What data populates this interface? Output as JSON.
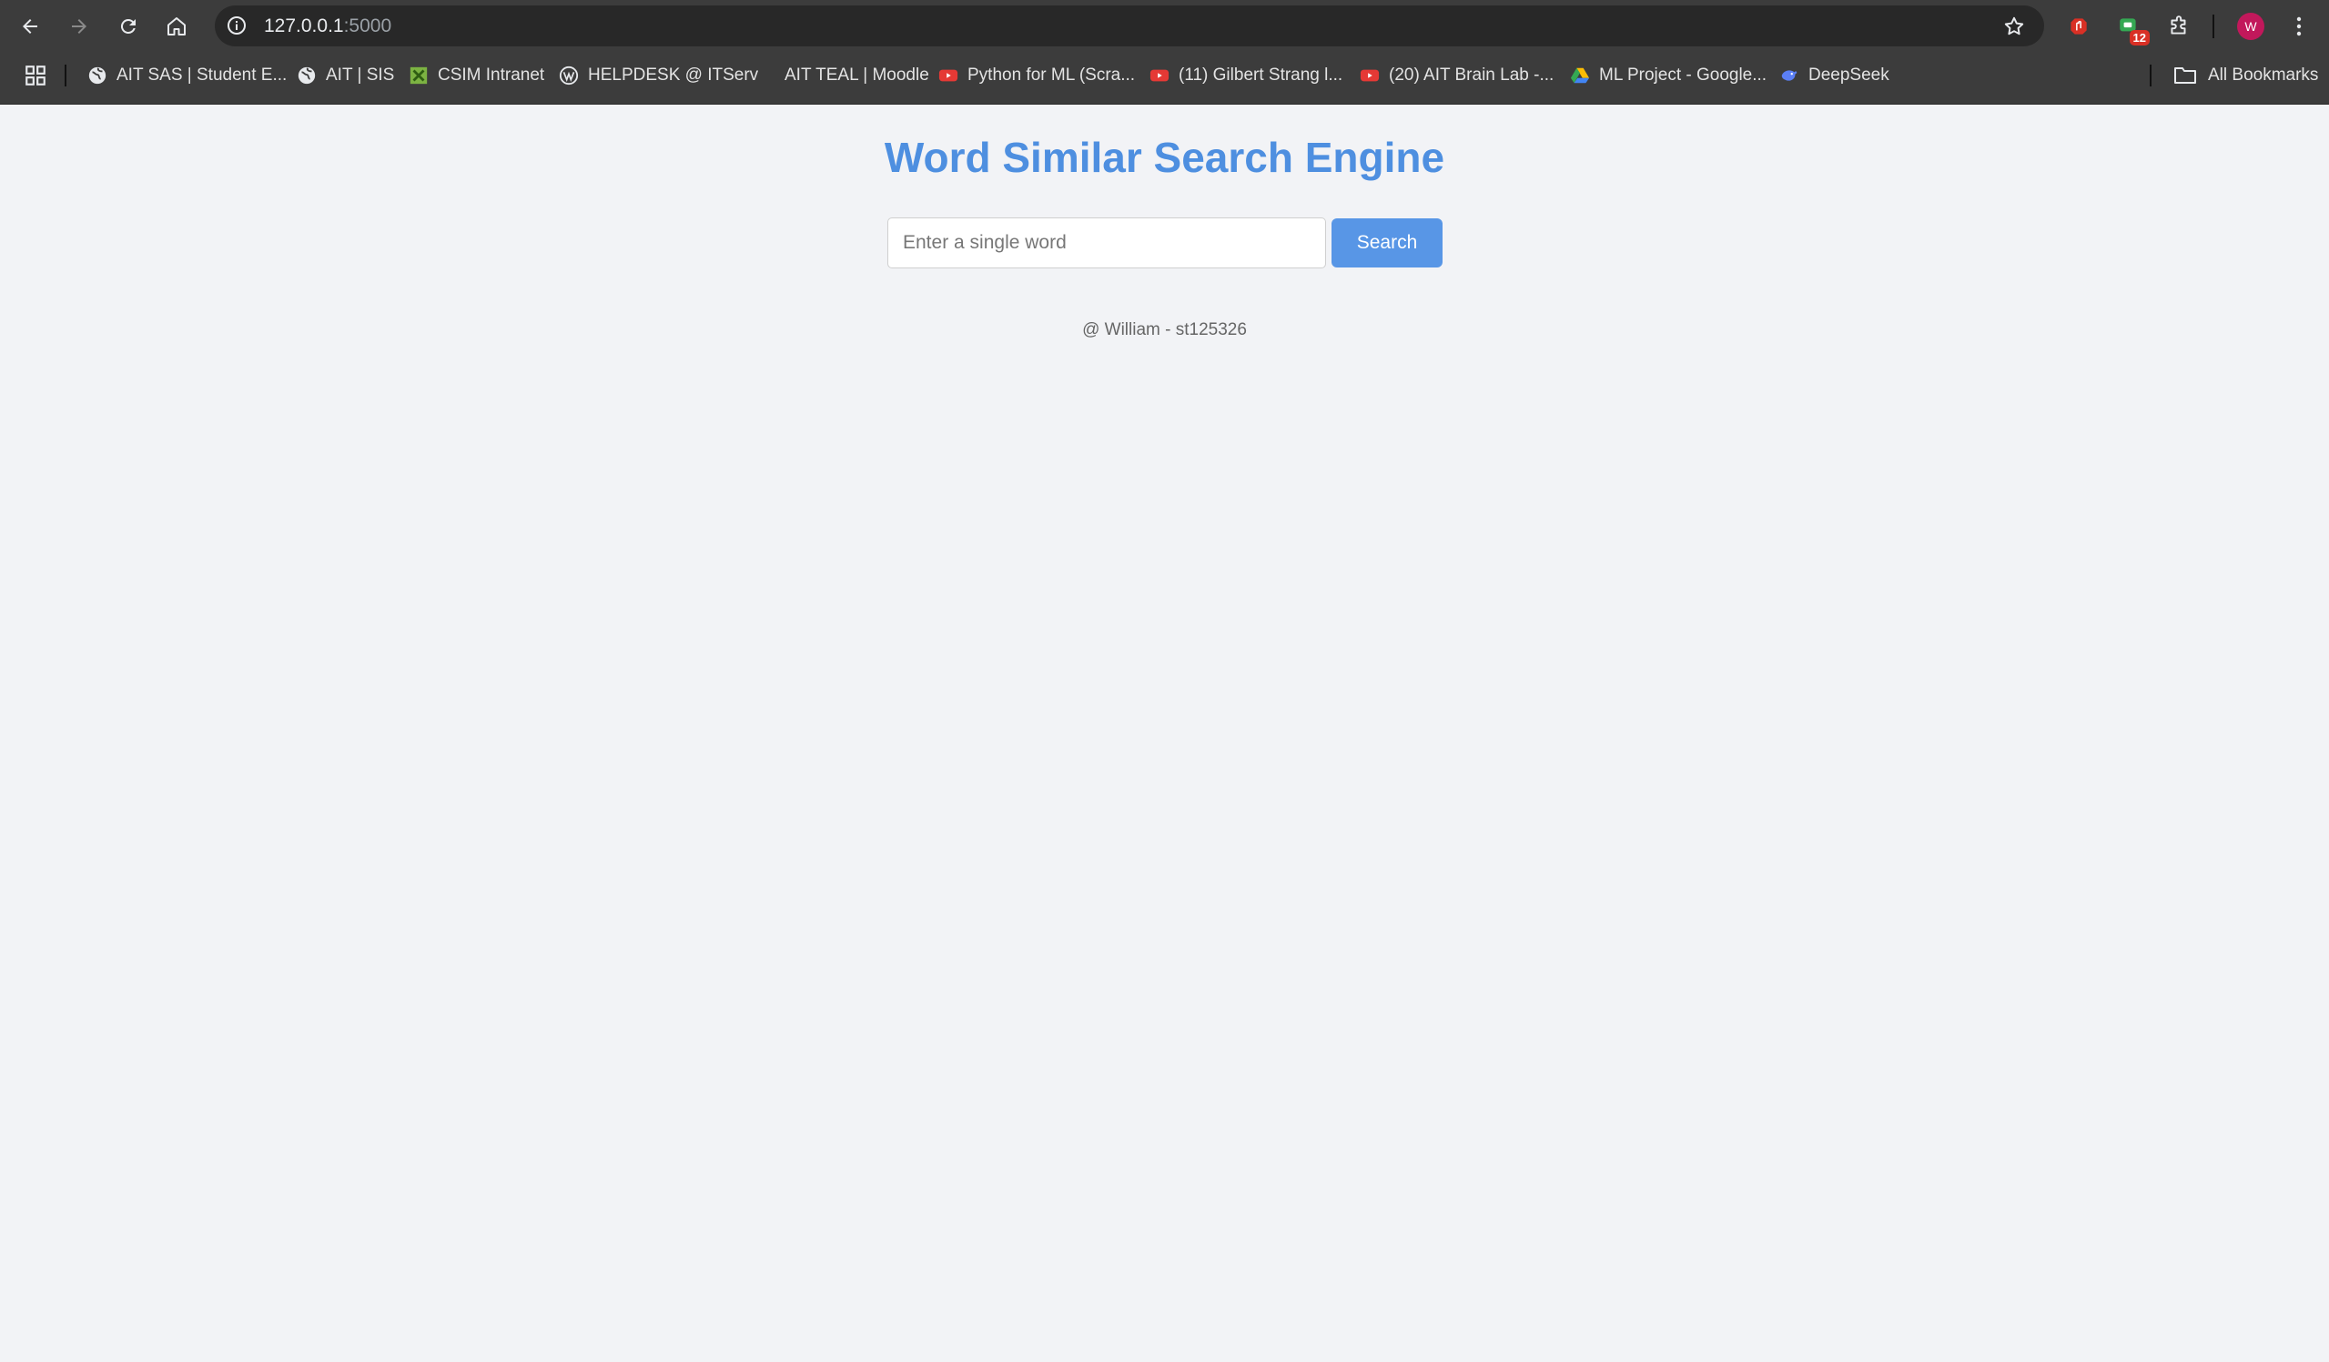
{
  "browser": {
    "url_host": "127.0.0.1",
    "url_port": ":5000",
    "extension_badge": "12",
    "avatar_letter": "W"
  },
  "bookmarks": {
    "items": [
      {
        "label": "AIT SAS | Student E...",
        "icon": "globe-icon"
      },
      {
        "label": "AIT | SIS",
        "icon": "globe-icon"
      },
      {
        "label": "CSIM Intranet",
        "icon": "csim-icon"
      },
      {
        "label": "HELPDESK @ ITServ",
        "icon": "wordpress-icon"
      },
      {
        "label": "AIT TEAL | Moodle",
        "icon": "moodle-icon"
      },
      {
        "label": "Python for ML (Scra...",
        "icon": "youtube-icon"
      },
      {
        "label": "(11) Gilbert Strang l...",
        "icon": "youtube-icon"
      },
      {
        "label": "(20) AIT Brain Lab -...",
        "icon": "youtube-icon"
      },
      {
        "label": "ML Project - Google...",
        "icon": "google-drive-icon"
      },
      {
        "label": "DeepSeek",
        "icon": "deepseek-icon"
      }
    ],
    "all_bookmarks_label": "All Bookmarks"
  },
  "page": {
    "title": "Word Similar Search Engine",
    "search_placeholder": "Enter a single word",
    "search_value": "",
    "search_button_label": "Search",
    "footer": "@ William - st125326"
  },
  "colors": {
    "accent": "#4e8fe0",
    "button": "#5896e6",
    "page_background": "#f2f3f6",
    "chrome_background": "#3c3c3c"
  }
}
